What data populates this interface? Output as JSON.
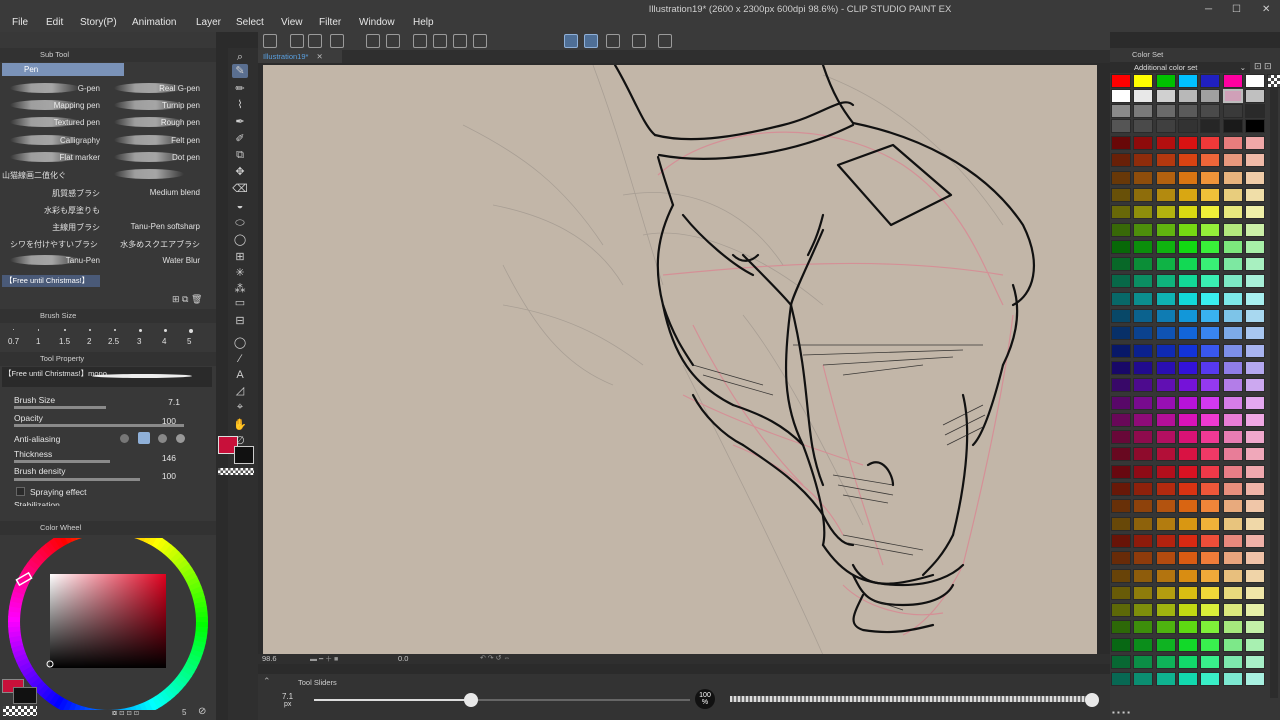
{
  "app": {
    "title": "Illustration19* (2600 x 2300px 600dpi 98.6%) - CLIP STUDIO PAINT EX",
    "menu": [
      "File",
      "Edit",
      "Story(P)",
      "Animation",
      "Layer",
      "Select",
      "View",
      "Filter",
      "Window",
      "Help"
    ]
  },
  "sub_tool": {
    "panel_title": "Sub Tool",
    "group": "Pen",
    "brushes_left": [
      "G-pen",
      "Mapping pen",
      "Textured pen",
      "Calligraphy",
      "Flat marker",
      "山猫線画二值化ぐ",
      "肌質感ブラシ",
      "水彩も厚塗りも",
      "主線用ブラシ",
      "シワを付けやすいブラシ",
      "Tanu-Pen"
    ],
    "brushes_right": [
      "Real G-pen",
      "Turnip pen",
      "Rough pen",
      "Felt pen",
      "Dot pen",
      "",
      "Medium blend",
      "",
      "Tanu-Pen softsharp",
      "水多めスクエアブラシ",
      "Water Blur"
    ],
    "mid_wide_label": "水彩も厚塗りも",
    "selected_brush": "【Free until Christmas!】"
  },
  "brush_size": {
    "title": "Brush Size",
    "sizes": [
      "0.7",
      "1",
      "1.5",
      "2",
      "2.5",
      "3",
      "4",
      "5"
    ]
  },
  "tool_property": {
    "title": "Tool Property",
    "brush_preset": "【Free until Christmas!】mono",
    "rows": [
      {
        "label": "Brush Size",
        "value": "7.1"
      },
      {
        "label": "Opacity",
        "value": "100"
      },
      {
        "label": "Anti-aliasing",
        "value": ""
      },
      {
        "label": "Thickness",
        "value": "146"
      },
      {
        "label": "Brush density",
        "value": "100"
      },
      {
        "label": "Spraying effect",
        "value": ""
      },
      {
        "label": "Stabilization",
        "value": ""
      }
    ]
  },
  "color_wheel": {
    "title": "Color Wheel",
    "main_color": "#c8103a",
    "sub_color": "#111111",
    "footer_value": "5"
  },
  "canvas": {
    "tab": "Illustration19*",
    "background": "#c2b6a8",
    "zoom": "98.6",
    "rotation": "0.0"
  },
  "tool_sliders": {
    "title": "Tool Sliders",
    "size_value": "7.1",
    "size_unit": "px",
    "opacity_value": "100",
    "opacity_unit": "%"
  },
  "color_set": {
    "title": "Color Set",
    "set_name": "Additional color set"
  }
}
